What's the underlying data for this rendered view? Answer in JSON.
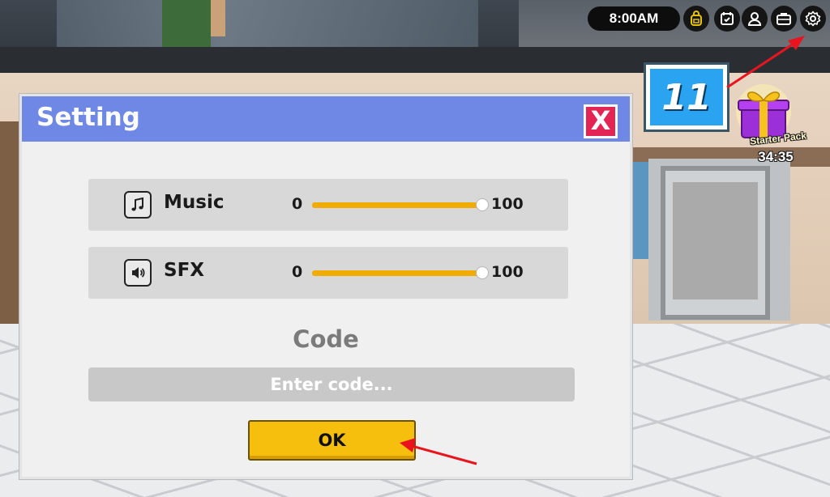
{
  "hud": {
    "time": "8:00AM",
    "buttons": [
      {
        "name": "backpack-icon",
        "color": "#e8c400"
      },
      {
        "name": "calendar-icon",
        "color": "#ffffff"
      },
      {
        "name": "profile-icon",
        "color": "#ffffff"
      },
      {
        "name": "briefcase-icon",
        "color": "#ffffff"
      },
      {
        "name": "gear-icon",
        "color": "#ffffff"
      }
    ]
  },
  "scene": {
    "tv_number": "11"
  },
  "starter_pack": {
    "label": "Starter Pack",
    "timer": "34:35",
    "icon": "gift-icon"
  },
  "settings": {
    "title": "Setting",
    "close_label": "X",
    "rows": [
      {
        "label": "Music",
        "icon": "music-note-icon",
        "min": "0",
        "max": "100",
        "value": 100
      },
      {
        "label": "SFX",
        "icon": "speaker-icon",
        "min": "0",
        "max": "100",
        "value": 100
      }
    ],
    "code": {
      "title": "Code",
      "placeholder": "Enter code...",
      "value": ""
    },
    "ok_label": "OK"
  },
  "colors": {
    "header": "#6f88e6",
    "close": "#e32556",
    "slider": "#f0ad00",
    "ok_button": "#f7bf0d",
    "annotation_arrow": "#e8141e"
  }
}
